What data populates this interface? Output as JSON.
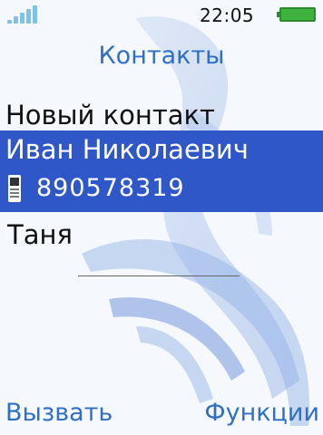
{
  "status": {
    "time": "22:05",
    "signal_icon": "signal-bars-icon",
    "battery_icon": "battery-full-icon",
    "battery_color": "#3fb23f"
  },
  "screen_title": "Контакты",
  "menu": {
    "new_contact": "Новый контакт",
    "selected_contact": {
      "name": "Иван Николаевич",
      "phone_icon": "mobile-phone-icon",
      "number": "890578319"
    },
    "contacts": [
      "Таня"
    ]
  },
  "softkeys": {
    "left": "Вызвать",
    "right": "Функции"
  },
  "colors": {
    "accent": "#2f6fc5",
    "highlight": "#2f57c7"
  }
}
